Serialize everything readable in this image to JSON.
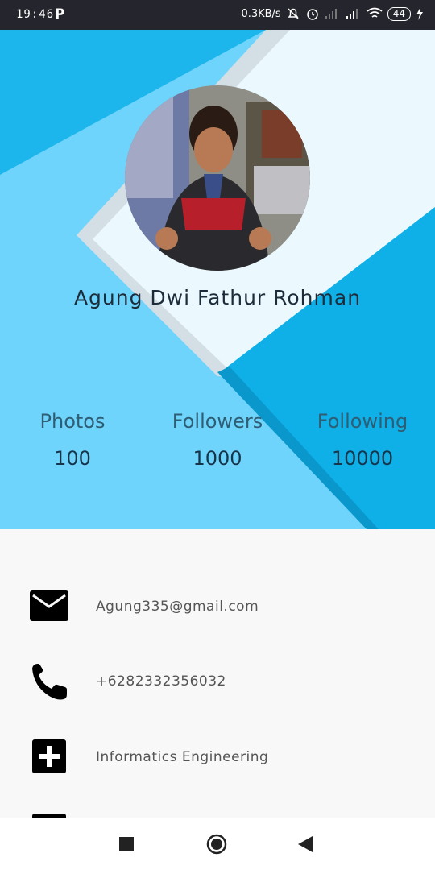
{
  "status_bar": {
    "time": "19:46",
    "app_indicator": "P",
    "net_speed": "0.3KB/s",
    "battery": "44",
    "icons": [
      "mute-bell-icon",
      "alarm-icon",
      "signal-icon",
      "signal-icon",
      "wifi-icon",
      "charging-icon"
    ]
  },
  "profile": {
    "name": "Agung Dwi Fathur Rohman",
    "stats": [
      {
        "label": "Photos",
        "value": "100"
      },
      {
        "label": "Followers",
        "value": "1000"
      },
      {
        "label": "Following",
        "value": "10000"
      }
    ]
  },
  "contacts": [
    {
      "icon": "email-icon",
      "text": "Agung335@gmail.com"
    },
    {
      "icon": "phone-icon",
      "text": "+6282332356032"
    },
    {
      "icon": "plus-box-icon",
      "text": "Informatics Engineering"
    }
  ],
  "colors": {
    "header_light": "#6fd4fb",
    "header_dark": "#10b3ea",
    "statusbar": "#25252d",
    "text_dark": "#1d2c3a"
  },
  "nav": {
    "buttons": [
      "recents-icon",
      "home-icon",
      "back-icon"
    ]
  }
}
